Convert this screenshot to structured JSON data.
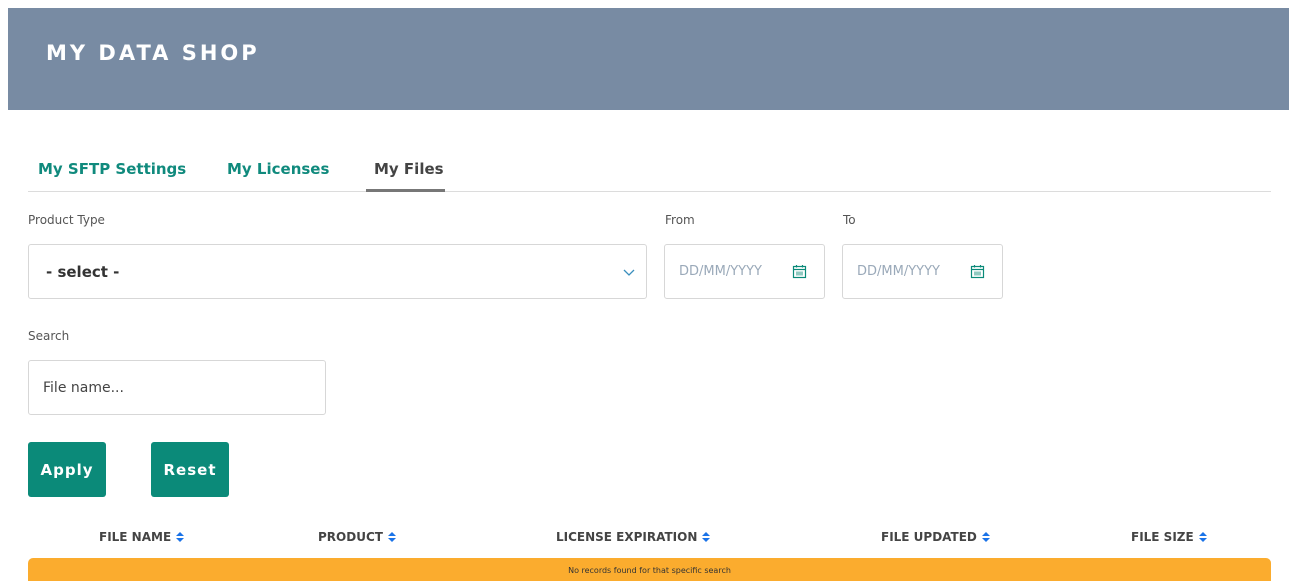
{
  "header": {
    "title": "MY DATA SHOP"
  },
  "tabs": [
    {
      "label": "My SFTP Settings",
      "active": false
    },
    {
      "label": "My Licenses",
      "active": false
    },
    {
      "label": "My Files",
      "active": true
    }
  ],
  "filters": {
    "product_type": {
      "label": "Product Type",
      "value": "- select -"
    },
    "from": {
      "label": "From",
      "placeholder": "DD/MM/YYYY"
    },
    "to": {
      "label": "To",
      "placeholder": "DD/MM/YYYY"
    },
    "search": {
      "label": "Search",
      "placeholder": "File name..."
    }
  },
  "buttons": {
    "apply": "Apply",
    "reset": "Reset"
  },
  "table": {
    "columns": [
      "FILE NAME",
      "PRODUCT",
      "LICENSE EXPIRATION",
      "FILE UPDATED",
      "FILE SIZE"
    ],
    "empty_message": "No records found for that specific search"
  },
  "colors": {
    "header_bg": "#788ba3",
    "accent": "#0b8a79",
    "tab_link": "#108a7d",
    "warning": "#fbac2e",
    "sort_icon": "#1a73e8"
  },
  "icons": {
    "dropdown": "chevron-down-icon",
    "date": "calendar-icon",
    "sort": "sort-icon"
  }
}
